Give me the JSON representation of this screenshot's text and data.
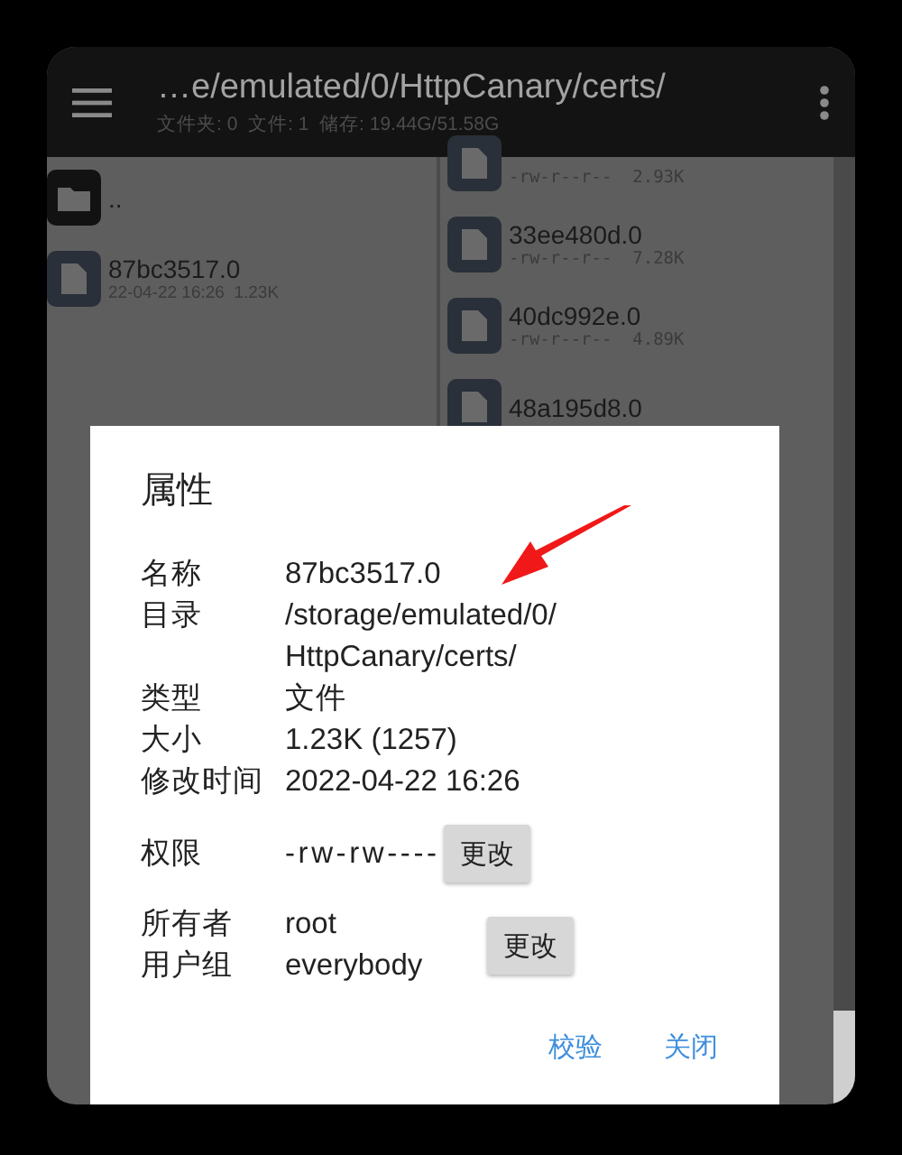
{
  "toolbar": {
    "path": "…e/emulated/0/HttpCanary/certs/",
    "summary": "文件夹: 0  文件: 1  储存: 19.44G/51.58G"
  },
  "left_pane": [
    {
      "kind": "folder",
      "name": ".."
    },
    {
      "kind": "file",
      "name": "87bc3517.0",
      "detail": "22-04-22 16:26  1.23K"
    }
  ],
  "right_pane": [
    {
      "kind": "file",
      "detail": "-rw-r--r--  2.93K"
    },
    {
      "kind": "file",
      "name": "33ee480d.0",
      "detail": "-rw-r--r--  7.28K"
    },
    {
      "kind": "file",
      "name": "40dc992e.0",
      "detail": "-rw-r--r--  4.89K"
    },
    {
      "kind": "file",
      "name": "48a195d8.0"
    }
  ],
  "dialog": {
    "title": "属性",
    "properties": [
      {
        "label": "名称",
        "value": "87bc3517.0"
      },
      {
        "label": "目录",
        "value": "/storage/emulated/0/\nHttpCanary/certs/"
      },
      {
        "label": "类型",
        "value": "文件"
      },
      {
        "label": "大小",
        "value": "1.23K (1257)"
      },
      {
        "label": "修改时间",
        "value": "2022-04-22 16:26"
      }
    ],
    "permission": {
      "label": "权限",
      "value": "-rw-rw----",
      "button": "更改"
    },
    "ownership": {
      "rows": [
        {
          "label": "所有者",
          "value": "root"
        },
        {
          "label": "用户组",
          "value": "everybody"
        }
      ],
      "button": "更改"
    },
    "actions": [
      "校验",
      "关闭"
    ]
  }
}
